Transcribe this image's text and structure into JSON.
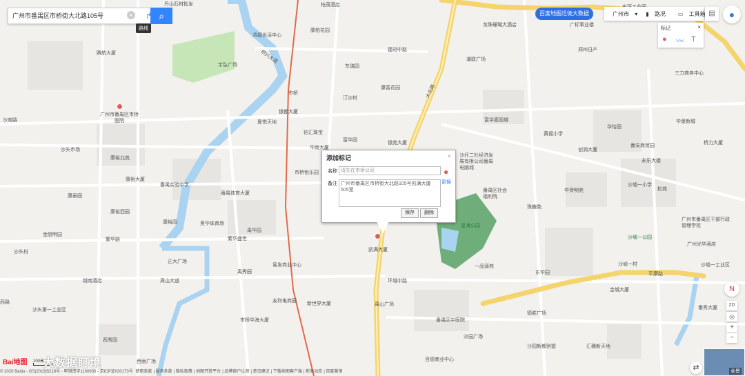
{
  "search": {
    "value": "广州市番禺区市桥街大北路105号",
    "clear_icon": "×",
    "route_icon": "↱",
    "search_icon": "⌕"
  },
  "tooltip": "路线",
  "bigdata_button": "百度地图迁徙大数据",
  "toolbar": {
    "city": "广州市",
    "traffic": "路况",
    "tools": "工具箱"
  },
  "marker_panel": {
    "title": "标记",
    "close": "×",
    "pin_icon": "📍",
    "line_icon": "〰",
    "text_icon": "T"
  },
  "dialog": {
    "title": "添加标记",
    "close": "×",
    "name_label": "名称",
    "name_placeholder": "请先在市桥公司",
    "note_label": "备注",
    "note_value": "广州市番禺区市桥街大北路105号凯满大厦505室",
    "change_link": "更换",
    "save": "保存",
    "delete": "删除"
  },
  "roads": [
    {
      "name": "捷进中路"
    },
    {
      "name": "桥兴大道"
    },
    {
      "name": "大北路"
    },
    {
      "name": "繁华路"
    },
    {
      "name": "环城中路"
    },
    {
      "name": "平康路"
    },
    {
      "name": "大北路"
    }
  ],
  "labels": [
    {
      "text": "广州市番禺区市桥医院",
      "type": "red"
    },
    {
      "text": "沙头市场",
      "type": "blue"
    },
    {
      "text": "康裕北苑",
      "type": "blue"
    },
    {
      "text": "康裕大厦",
      "type": "blue"
    },
    {
      "text": "番禺实验中学",
      "type": "blue"
    },
    {
      "text": "番禺体育大厦",
      "type": "blue"
    },
    {
      "text": "康泰园",
      "type": "blue"
    },
    {
      "text": "康裕西园",
      "type": "blue"
    },
    {
      "text": "康裕园",
      "type": "blue"
    },
    {
      "text": "英华体育场",
      "type": "blue"
    },
    {
      "text": "禹华园",
      "type": "blue"
    },
    {
      "text": "繁华盛世",
      "type": "red"
    },
    {
      "text": "金厨明园",
      "type": "blue"
    },
    {
      "text": "沙头村",
      "type": "blue"
    },
    {
      "text": "正大广场",
      "type": "blue"
    },
    {
      "text": "越南酒店",
      "type": "blue"
    },
    {
      "text": "易发商业中心",
      "type": "blue"
    },
    {
      "text": "禹秀园",
      "type": "blue"
    },
    {
      "text": "友利电商园",
      "type": "blue"
    },
    {
      "text": "新世界大厦",
      "type": "blue"
    },
    {
      "text": "市桥华海大厦",
      "type": "blue"
    },
    {
      "text": "沙头第一工业区",
      "type": "blue"
    },
    {
      "text": "西秀园",
      "type": "blue"
    },
    {
      "text": "西丽广场",
      "type": "blue"
    },
    {
      "text": "市桥",
      "type": "red"
    },
    {
      "text": "银都大厦",
      "type": "blue"
    },
    {
      "text": "夏悦天地",
      "type": "blue"
    },
    {
      "text": "钻汇珠宝",
      "type": "pink"
    },
    {
      "text": "华南大厦",
      "type": "blue"
    },
    {
      "text": "市桥怡乐园",
      "type": "blue"
    },
    {
      "text": "富华园",
      "type": "blue"
    },
    {
      "text": "银苑大厦",
      "type": "blue"
    },
    {
      "text": "汀沙村",
      "type": "blue"
    },
    {
      "text": "康富花园",
      "type": "blue"
    },
    {
      "text": "东瑞园",
      "type": "blue"
    },
    {
      "text": "捷进中路",
      "type": "road"
    },
    {
      "text": "潮联广场",
      "type": "blue"
    },
    {
      "text": "郑州日产",
      "type": "blue"
    },
    {
      "text": "三力商务中心",
      "type": "blue"
    },
    {
      "text": "富华嘉园城",
      "type": "pink"
    },
    {
      "text": "黄福小学",
      "type": "blue"
    },
    {
      "text": "华怡园",
      "type": "blue"
    },
    {
      "text": "华景新城",
      "type": "blue"
    },
    {
      "text": "创润大厦",
      "type": "blue"
    },
    {
      "text": "番安商贸园",
      "type": "blue"
    },
    {
      "text": "桥力大厦",
      "type": "blue"
    },
    {
      "text": "永乐大楼",
      "type": "blue"
    },
    {
      "text": "沙圩二社经济发展有限公司番禺电脑城",
      "type": "pink"
    },
    {
      "text": "番禺区社会福利院",
      "type": "red"
    },
    {
      "text": "华贺明苑",
      "type": "blue"
    },
    {
      "text": "沙墟一小学",
      "type": "blue"
    },
    {
      "text": "松苑",
      "type": "blue"
    },
    {
      "text": "珠巍苑",
      "type": "blue"
    },
    {
      "text": "星海公园",
      "type": "green"
    },
    {
      "text": "广州市番禺区干部行政管理学校",
      "type": "blue"
    },
    {
      "text": "沙墟一公园",
      "type": "green"
    },
    {
      "text": "广州光华酒店",
      "type": "blue"
    },
    {
      "text": "一品源苑",
      "type": "blue"
    },
    {
      "text": "沙墟一村",
      "type": "blue"
    },
    {
      "text": "沙墟一工业区",
      "type": "blue"
    },
    {
      "text": "东华园",
      "type": "blue"
    },
    {
      "text": "金城大厦",
      "type": "blue"
    },
    {
      "text": "番秀大厦",
      "type": "pink"
    },
    {
      "text": "凯满大厦",
      "type": "blue"
    },
    {
      "text": "禹山广场",
      "type": "blue"
    },
    {
      "text": "德胜广场",
      "type": "blue"
    },
    {
      "text": "番禺区中医院",
      "type": "red"
    },
    {
      "text": "沙园广场",
      "type": "blue"
    },
    {
      "text": "沙园新都别墅",
      "type": "blue"
    },
    {
      "text": "汇穗新天地",
      "type": "blue"
    },
    {
      "text": "百德商业中心",
      "type": "blue"
    },
    {
      "text": "龙珠珊瑚大酒店",
      "type": "blue"
    },
    {
      "text": "康柏花园",
      "type": "blue"
    },
    {
      "text": "广标事业楼",
      "type": "blue"
    },
    {
      "text": "腾航大厦",
      "type": "blue"
    },
    {
      "text": "宇弘广场",
      "type": "blue"
    },
    {
      "text": "鸿福优活中心",
      "type": "blue"
    },
    {
      "text": "柏茂酒店",
      "type": "blue"
    },
    {
      "text": "东环工业园",
      "type": "blue"
    },
    {
      "text": "丹山石材批发",
      "type": "blue"
    },
    {
      "text": "沙南路",
      "type": "road"
    },
    {
      "text": "繁华路",
      "type": "road"
    },
    {
      "text": "周山大道",
      "type": "road"
    },
    {
      "text": "环城中路",
      "type": "road"
    },
    {
      "text": "平康路",
      "type": "road"
    },
    {
      "text": "西路",
      "type": "road"
    }
  ],
  "controls": {
    "compass": "N",
    "mode_2d": "2D",
    "locate": "◎",
    "zoom_in": "+",
    "zoom_out": "−",
    "swap": "⇄",
    "pano_label": "全景"
  },
  "scale_text": "100米",
  "logo": "Bai地图",
  "watermark": "大数据盯境",
  "footer": [
    "© 2020 Baidu - GS(2019)5218号 - 甲测资字1100930 - 京ICP证030173号",
    "使用条款",
    "服务条款",
    "隐私政策",
    "地图开放平台",
    "品牌商户认领",
    "意见建议",
    "下载地图客户端",
    "新激动态",
    "百度营销"
  ],
  "colors": {
    "search_blue": "#3385ff",
    "bigdata_blue": "#2f6fe4",
    "park_green": "#4f9d5f",
    "rail_red": "#e26a4a",
    "arterial_yellow": "#f4d46b"
  }
}
